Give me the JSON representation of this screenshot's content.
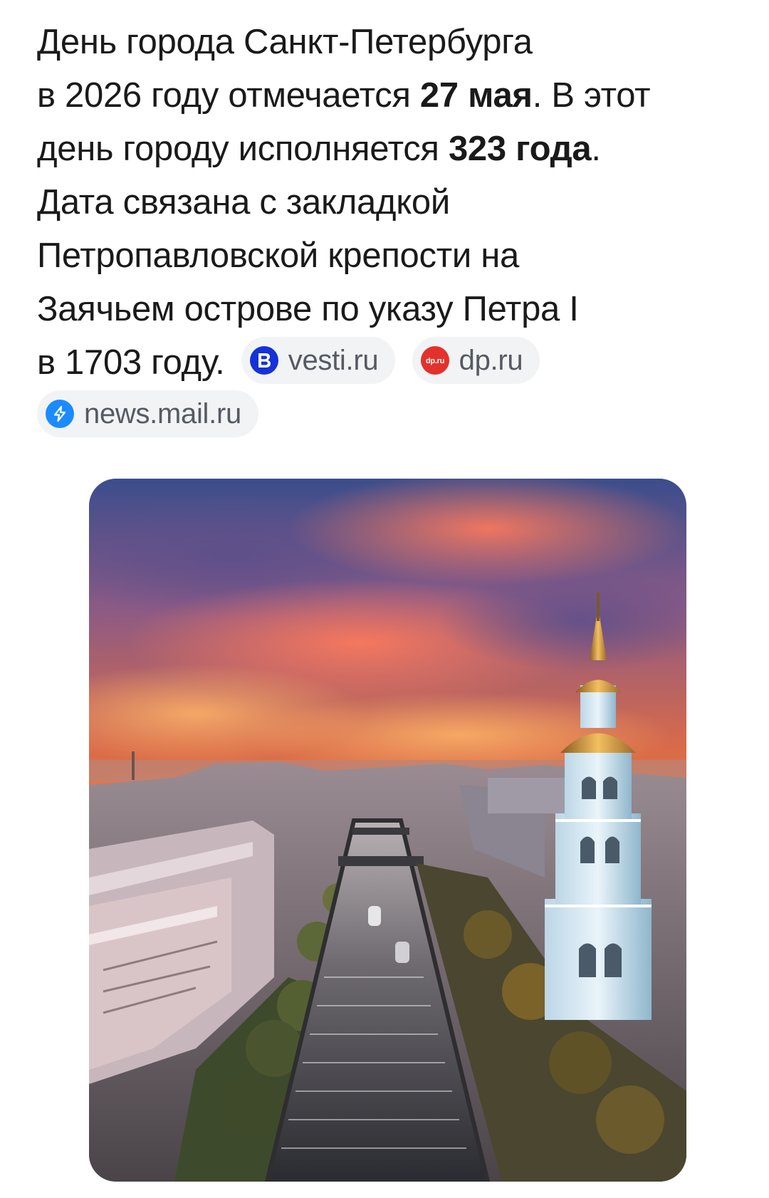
{
  "answer": {
    "line1": "День города Санкт-Петербурга",
    "line2_pre": "в 2026 году отмечается ",
    "line2_bold": "27 мая",
    "line2_post": ". В этот",
    "line3_pre": "день городу исполняется ",
    "line3_bold": "323 года",
    "line3_post": ".",
    "line4": "Дата связана с закладкой",
    "line5": "Петропавловской крепости на",
    "line6": "Заячьем острове по указу Петра I",
    "line7": "в 1703 году."
  },
  "sources": [
    {
      "label": "vesti.ru",
      "icon": "vesti-logo-icon",
      "color": "#1432d8"
    },
    {
      "label": "dp.ru",
      "icon": "dp-logo-icon",
      "color": "#e3322b",
      "logo_text": "dp.ru"
    },
    {
      "label": "news.mail.ru",
      "icon": "lightning-icon",
      "color": "#1a8cff"
    }
  ],
  "photo": {
    "subject": "sunset-aerial-canal-bell-tower"
  }
}
